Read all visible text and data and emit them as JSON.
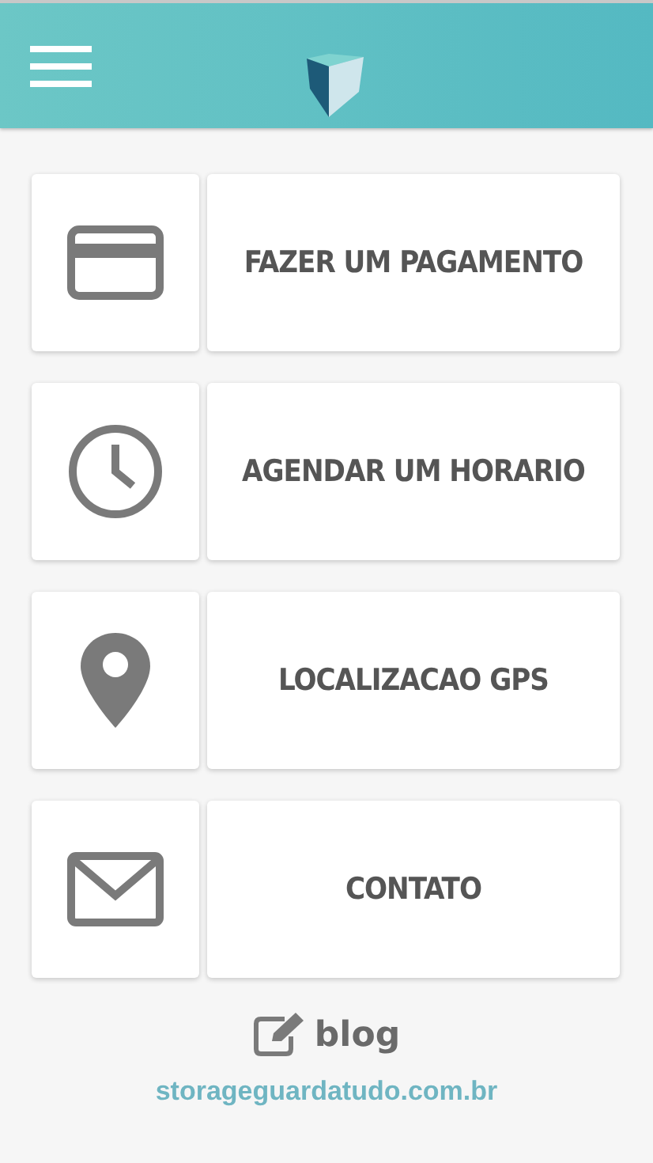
{
  "menu": [
    {
      "kind": "card",
      "label": "FAZER UM PAGAMENTO"
    },
    {
      "kind": "clock",
      "label": "AGENDAR UM HORARIO"
    },
    {
      "kind": "pin",
      "label": "LOCALIZACAO GPS"
    },
    {
      "kind": "mail",
      "label": "CONTATO"
    }
  ],
  "blog": {
    "label": "blog"
  },
  "footer": {
    "url": "storageguardatudo.com.br"
  }
}
